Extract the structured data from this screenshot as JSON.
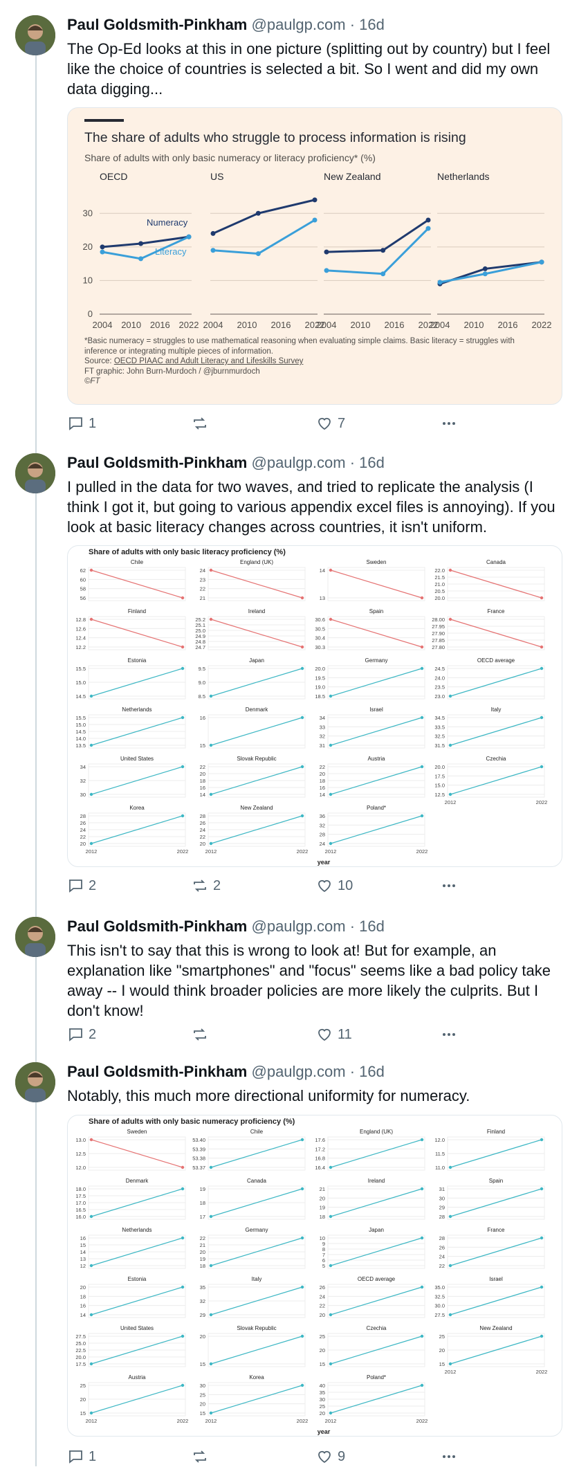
{
  "author": {
    "name": "Paul Goldsmith-Pinkham",
    "handle": "@paulgp.com",
    "separator": "·"
  },
  "colors": {
    "accent_red": "#e57373",
    "accent_teal": "#3db7c4",
    "ft_bg": "#fdf1e5",
    "ft_dark": "#1f3a6e",
    "ft_light": "#3a9fd9"
  },
  "posts": [
    {
      "time": "16d",
      "text": "The Op-Ed looks at this in one picture (splitting out by country) but I feel like the choice of countries is selected a bit. So I went and did my own data digging...",
      "replies": "1",
      "reposts": "",
      "likes": "7"
    },
    {
      "time": "16d",
      "text": "I pulled in the data for two waves, and tried to replicate the analysis (I think I got it, but going to various appendix excel files is annoying). If you look at basic literacy changes across countries, it isn't uniform.",
      "replies": "2",
      "reposts": "2",
      "likes": "10"
    },
    {
      "time": "16d",
      "text": "This isn't to say that this is wrong to look at! But for example, an explanation like \"smartphones\" and \"focus\" seems like a bad policy take away -- I would think broader policies are more likely the culprits. But I don't know!",
      "replies": "2",
      "reposts": "",
      "likes": "11"
    },
    {
      "time": "16d",
      "text": "Notably, this much more directional uniformity for numeracy.",
      "replies": "1",
      "reposts": "",
      "likes": "9"
    }
  ],
  "ft_chart": {
    "title": "The share of adults who struggle to process information is rising",
    "subtitle": "Share of adults with only basic numeracy or literacy proficiency* (%)",
    "footnote": "*Basic numeracy = struggles to use mathematical reasoning when evaluating simple claims. Basic literacy = struggles with inference or integrating multiple pieces of information.",
    "source_prefix": "Source: ",
    "source_link": "OECD PIAAC and Adult Literacy and Lifeskills Survey",
    "credit": "FT graphic: John Burn-Murdoch / @jburnmurdoch",
    "copyright": "©FT",
    "series_labels": {
      "numeracy": "Numeracy",
      "literacy": "Literacy"
    },
    "y_ticks": [
      "0",
      "10",
      "20",
      "30"
    ],
    "x_ticks": [
      "2004",
      "2010",
      "2016",
      "2022"
    ]
  },
  "chart_data": [
    {
      "type": "line",
      "title": "The share of adults who struggle to process information is rising",
      "subtitle": "Share of adults with only basic numeracy or literacy proficiency* (%)",
      "ylim": [
        0,
        35
      ],
      "panels": [
        {
          "name": "OECD",
          "series": [
            {
              "name": "Numeracy",
              "x": [
                2004,
                2012,
                2022
              ],
              "y": [
                20,
                21,
                23
              ]
            },
            {
              "name": "Literacy",
              "x": [
                2004,
                2012,
                2022
              ],
              "y": [
                18.5,
                16.5,
                23
              ]
            }
          ]
        },
        {
          "name": "US",
          "series": [
            {
              "name": "Numeracy",
              "x": [
                2004,
                2012,
                2022
              ],
              "y": [
                24,
                30,
                34
              ]
            },
            {
              "name": "Literacy",
              "x": [
                2004,
                2012,
                2022
              ],
              "y": [
                19,
                18,
                28
              ]
            }
          ]
        },
        {
          "name": "New Zealand",
          "series": [
            {
              "name": "Numeracy",
              "x": [
                2004,
                2014,
                2022
              ],
              "y": [
                18.5,
                19,
                28
              ]
            },
            {
              "name": "Literacy",
              "x": [
                2004,
                2014,
                2022
              ],
              "y": [
                13,
                12,
                25.5
              ]
            }
          ]
        },
        {
          "name": "Netherlands",
          "series": [
            {
              "name": "Numeracy",
              "x": [
                2004,
                2012,
                2022
              ],
              "y": [
                9,
                13.5,
                15.5
              ]
            },
            {
              "name": "Literacy",
              "x": [
                2004,
                2012,
                2022
              ],
              "y": [
                9.5,
                12,
                15.5
              ]
            }
          ]
        }
      ]
    },
    {
      "type": "line",
      "title": "Share of adults with only basic literacy proficiency (%)",
      "xlabel": "year",
      "x": [
        2012,
        2022
      ],
      "panels": [
        {
          "name": "Chile",
          "y": [
            62,
            56
          ],
          "ticks": [
            "62",
            "60",
            "58",
            "56"
          ],
          "dir": "down"
        },
        {
          "name": "England (UK)",
          "y": [
            24,
            21
          ],
          "ticks": [
            "24",
            "23",
            "22",
            "21"
          ],
          "dir": "down"
        },
        {
          "name": "Sweden",
          "y": [
            14.5,
            12.2
          ],
          "ticks": [
            "14",
            "13"
          ],
          "dir": "down"
        },
        {
          "name": "Canada",
          "y": [
            22.2,
            20
          ],
          "ticks": [
            "22.0",
            "21.5",
            "21.0",
            "20.5",
            "20.0"
          ],
          "dir": "down"
        },
        {
          "name": "Finland",
          "y": [
            12.8,
            12.2
          ],
          "ticks": [
            "12.8",
            "12.6",
            "12.4",
            "12.2"
          ],
          "dir": "down"
        },
        {
          "name": "Ireland",
          "y": [
            25.2,
            24.7
          ],
          "ticks": [
            "25.2",
            "25.1",
            "25.0",
            "24.9",
            "24.8",
            "24.7"
          ],
          "dir": "down"
        },
        {
          "name": "Spain",
          "y": [
            30.7,
            30.3
          ],
          "ticks": [
            "30.6",
            "30.5",
            "30.4",
            "30.3"
          ],
          "dir": "down"
        },
        {
          "name": "France",
          "y": [
            28.03,
            27.8
          ],
          "ticks": [
            "28.00",
            "27.95",
            "27.90",
            "27.85",
            "27.80"
          ],
          "dir": "down"
        },
        {
          "name": "Estonia",
          "y": [
            14.3,
            15.9
          ],
          "ticks": [
            "15.5",
            "15.0",
            "14.5"
          ],
          "dir": "up"
        },
        {
          "name": "Japan",
          "y": [
            8.2,
            9.9
          ],
          "ticks": [
            "9.5",
            "9.0",
            "8.5"
          ],
          "dir": "up"
        },
        {
          "name": "Germany",
          "y": [
            18.3,
            20.2
          ],
          "ticks": [
            "20.0",
            "19.5",
            "19.0",
            "18.5"
          ],
          "dir": "up"
        },
        {
          "name": "OECD average",
          "y": [
            22.6,
            25
          ],
          "ticks": [
            "24.5",
            "24.0",
            "23.5",
            "23.0"
          ],
          "dir": "up"
        },
        {
          "name": "Netherlands",
          "y": [
            13.3,
            15.4
          ],
          "ticks": [
            "15.5",
            "15.0",
            "14.5",
            "14.0",
            "13.5"
          ],
          "dir": "up"
        },
        {
          "name": "Denmark",
          "y": [
            14.3,
            16.8
          ],
          "ticks": [
            "16",
            "15"
          ],
          "dir": "up"
        },
        {
          "name": "Israel",
          "y": [
            30.5,
            34
          ],
          "ticks": [
            "34",
            "33",
            "32",
            "31"
          ],
          "dir": "up"
        },
        {
          "name": "Italy",
          "y": [
            31.2,
            35
          ],
          "ticks": [
            "34.5",
            "33.5",
            "32.5",
            "31.5"
          ],
          "dir": "up"
        },
        {
          "name": "United States",
          "y": [
            29,
            34
          ],
          "ticks": [
            "34",
            "32",
            "30"
          ],
          "dir": "up"
        },
        {
          "name": "Slovak Republic",
          "y": [
            13.5,
            22
          ],
          "ticks": [
            "22",
            "20",
            "18",
            "16",
            "14"
          ],
          "dir": "up"
        },
        {
          "name": "Austria",
          "y": [
            14,
            24
          ],
          "ticks": [
            "22",
            "20",
            "18",
            "16",
            "14"
          ],
          "dir": "up"
        },
        {
          "name": "Czechia",
          "y": [
            12.5,
            22.5
          ],
          "ticks": [
            "20.0",
            "17.5",
            "15.0",
            "12.5"
          ],
          "dir": "up"
        },
        {
          "name": "Korea",
          "y": [
            19,
            28
          ],
          "ticks": [
            "28",
            "26",
            "24",
            "22",
            "20"
          ],
          "dir": "up"
        },
        {
          "name": "New Zealand",
          "y": [
            20,
            28
          ],
          "ticks": [
            "28",
            "26",
            "24",
            "22",
            "20"
          ],
          "dir": "up"
        },
        {
          "name": "Poland*",
          "y": [
            24,
            37
          ],
          "ticks": [
            "36",
            "32",
            "28",
            "24"
          ],
          "dir": "up"
        }
      ]
    },
    {
      "type": "line",
      "title": "Share of adults with only basic numeracy proficiency (%)",
      "xlabel": "year",
      "x": [
        2012,
        2022
      ],
      "panels": [
        {
          "name": "Sweden",
          "y": [
            13.8,
            12
          ],
          "ticks": [
            "13.0",
            "12.5",
            "12.0"
          ],
          "dir": "down"
        },
        {
          "name": "Chile",
          "y": [
            53.37,
            53.41
          ],
          "ticks": [
            "53.40",
            "53.39",
            "53.38",
            "53.37"
          ],
          "dir": "up"
        },
        {
          "name": "England (UK)",
          "y": [
            16.4,
            17.6
          ],
          "ticks": [
            "17.6",
            "17.2",
            "16.8",
            "16.4"
          ],
          "dir": "up"
        },
        {
          "name": "Finland",
          "y": [
            10.7,
            12.5
          ],
          "ticks": [
            "12.0",
            "11.5",
            "11.0"
          ],
          "dir": "up"
        },
        {
          "name": "Denmark",
          "y": [
            15.6,
            18.1
          ],
          "ticks": [
            "18.0",
            "17.5",
            "17.0",
            "16.5",
            "16.0"
          ],
          "dir": "up"
        },
        {
          "name": "Canada",
          "y": [
            16,
            20
          ],
          "ticks": [
            "19",
            "18",
            "17"
          ],
          "dir": "up"
        },
        {
          "name": "Ireland",
          "y": [
            17.5,
            21.5
          ],
          "ticks": [
            "21",
            "20",
            "19",
            "18"
          ],
          "dir": "up"
        },
        {
          "name": "Spain",
          "y": [
            27,
            32
          ],
          "ticks": [
            "31",
            "30",
            "29",
            "28"
          ],
          "dir": "up"
        },
        {
          "name": "Netherlands",
          "y": [
            12,
            16
          ],
          "ticks": [
            "16",
            "15",
            "14",
            "13",
            "12"
          ],
          "dir": "up"
        },
        {
          "name": "Germany",
          "y": [
            17.5,
            22.5
          ],
          "ticks": [
            "22",
            "21",
            "20",
            "19",
            "18"
          ],
          "dir": "up"
        },
        {
          "name": "Japan",
          "y": [
            5,
            10.5
          ],
          "ticks": [
            "10",
            "9",
            "8",
            "7",
            "6",
            "5"
          ],
          "dir": "up"
        },
        {
          "name": "France",
          "y": [
            21,
            28.5
          ],
          "ticks": [
            "28",
            "26",
            "24",
            "22"
          ],
          "dir": "up"
        },
        {
          "name": "Estonia",
          "y": [
            13.5,
            20.5
          ],
          "ticks": [
            "20",
            "18",
            "16",
            "14"
          ],
          "dir": "up"
        },
        {
          "name": "Italy",
          "y": [
            27,
            36
          ],
          "ticks": [
            "35",
            "32",
            "29"
          ],
          "dir": "up"
        },
        {
          "name": "OECD average",
          "y": [
            19,
            27
          ],
          "ticks": [
            "26",
            "24",
            "22",
            "20"
          ],
          "dir": "up"
        },
        {
          "name": "Israel",
          "y": [
            27,
            37
          ],
          "ticks": [
            "35.0",
            "32.5",
            "30.0",
            "27.5"
          ],
          "dir": "up"
        },
        {
          "name": "United States",
          "y": [
            16,
            29
          ],
          "ticks": [
            "27.5",
            "25.0",
            "22.5",
            "20.0",
            "17.5"
          ],
          "dir": "up"
        },
        {
          "name": "Slovak Republic",
          "y": [
            13,
            26
          ],
          "ticks": [
            "20",
            "15"
          ],
          "dir": "up"
        },
        {
          "name": "Czechia",
          "y": [
            12,
            26
          ],
          "ticks": [
            "25",
            "20",
            "15"
          ],
          "dir": "up"
        },
        {
          "name": "New Zealand",
          "y": [
            12,
            26
          ],
          "ticks": [
            "25",
            "20",
            "15"
          ],
          "dir": "up"
        },
        {
          "name": "Austria",
          "y": [
            14,
            31
          ],
          "ticks": [
            "25",
            "20",
            "15"
          ],
          "dir": "up"
        },
        {
          "name": "Korea",
          "y": [
            15,
            31
          ],
          "ticks": [
            "30",
            "25",
            "20",
            "15"
          ],
          "dir": "up"
        },
        {
          "name": "Poland*",
          "y": [
            20,
            42
          ],
          "ticks": [
            "40",
            "35",
            "30",
            "25",
            "20"
          ],
          "dir": "up"
        }
      ]
    }
  ],
  "small_multiples_axis": {
    "x_start": "2012",
    "x_end": "2022",
    "xlabel": "year"
  }
}
